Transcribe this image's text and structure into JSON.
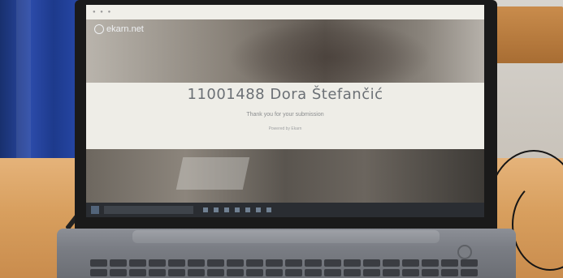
{
  "logo": {
    "text": "ekarn.net"
  },
  "page": {
    "title": "11001488 Dora Štefančić",
    "subtitle": "Thank you for your submission",
    "small_link": "Powered by Ekarn"
  },
  "colors": {
    "curtain": "#2b4aa8",
    "desk": "#d89f5e",
    "laptop_body": "#7a7d84",
    "screen_content_bg": "#eeede7",
    "taskbar": "#2a2d32"
  }
}
